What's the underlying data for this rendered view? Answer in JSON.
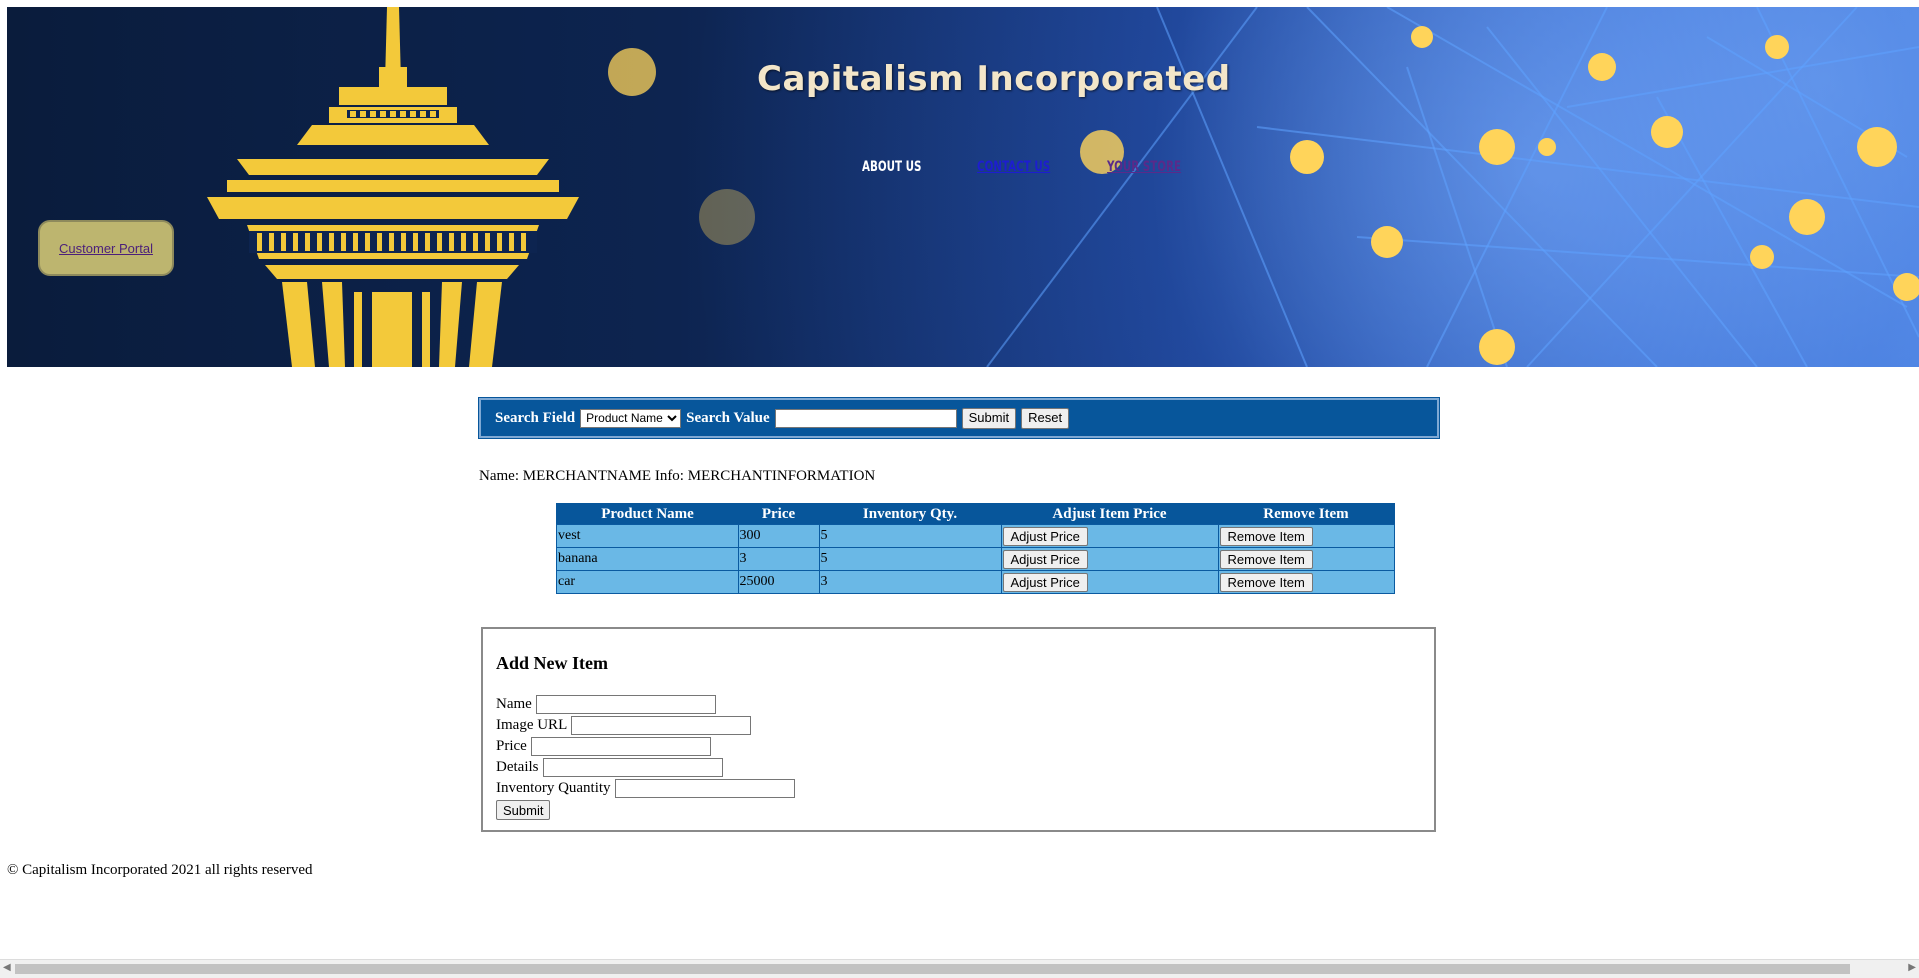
{
  "header": {
    "brand_title": "Capitalism Incorporated",
    "nav": {
      "about": "ABOUT US",
      "contact": "CONTACT US",
      "store": "YOUR STORE"
    },
    "portal_button": "Customer Portal"
  },
  "search": {
    "field_label": "Search Field",
    "field_options": [
      "Product Name"
    ],
    "field_selected": "Product Name",
    "value_label": "Search Value",
    "value_text": "",
    "submit_label": "Submit",
    "reset_label": "Reset"
  },
  "merchant": {
    "line": "Name: MERCHANTNAME Info: MERCHANTINFORMATION"
  },
  "items_table": {
    "columns": [
      "Product Name",
      "Price",
      "Inventory Qty.",
      "Adjust Item Price",
      "Remove Item"
    ],
    "rows": [
      {
        "name": "vest",
        "price": "300",
        "qty": "5",
        "adjust": "Adjust Price",
        "remove": "Remove Item"
      },
      {
        "name": "banana",
        "price": "3",
        "qty": "5",
        "adjust": "Adjust Price",
        "remove": "Remove Item"
      },
      {
        "name": "car",
        "price": "25000",
        "qty": "3",
        "adjust": "Adjust Price",
        "remove": "Remove Item"
      }
    ]
  },
  "add_item": {
    "heading": "Add New Item",
    "name_label": "Name",
    "image_label": "Image URL",
    "price_label": "Price",
    "details_label": "Details",
    "qty_label": "Inventory Quantity",
    "submit_label": "Submit"
  },
  "footer": {
    "text": "© Capitalism Incorporated 2021 all rights reserved"
  },
  "colors": {
    "header_bar": "#07569b",
    "table_row": "#6ab8e6",
    "needle_gold": "#f3c93a",
    "portal_button": "#bdb56f"
  }
}
